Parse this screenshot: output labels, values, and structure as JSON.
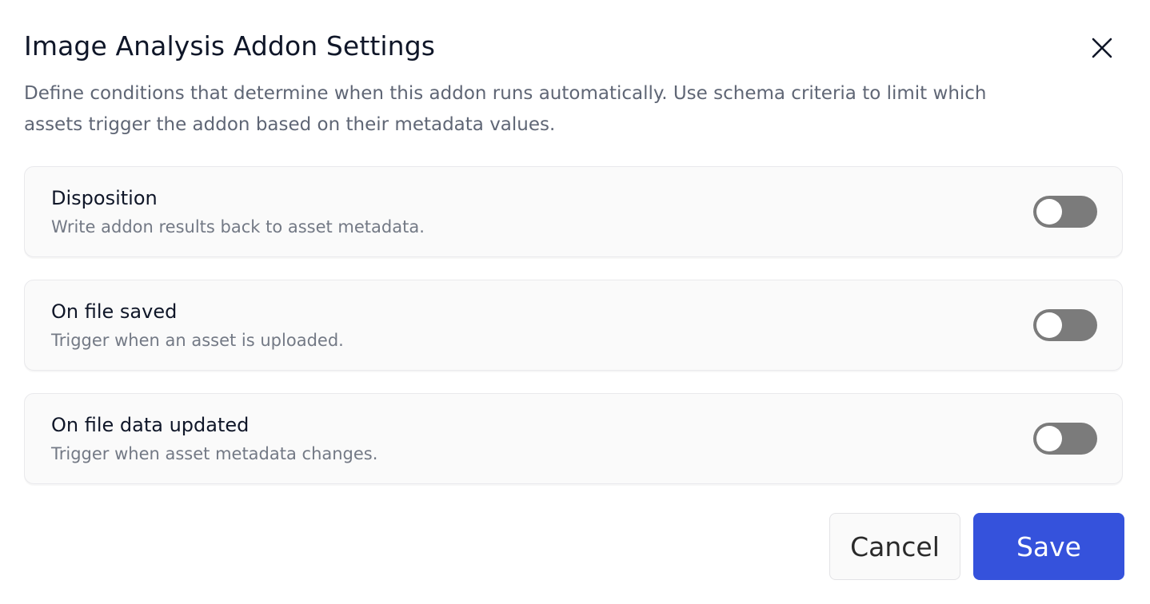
{
  "dialog": {
    "title": "Image Analysis Addon Settings",
    "description": "Define conditions that determine when this addon runs automatically. Use schema criteria to limit which assets trigger the addon based on their metadata values.",
    "close_icon": "close-icon"
  },
  "settings": [
    {
      "title": "Disposition",
      "description": "Write addon results back to asset metadata.",
      "enabled": false
    },
    {
      "title": "On file saved",
      "description": "Trigger when an asset is uploaded.",
      "enabled": false
    },
    {
      "title": "On file data updated",
      "description": "Trigger when asset metadata changes.",
      "enabled": false
    }
  ],
  "actions": {
    "cancel_label": "Cancel",
    "save_label": "Save"
  },
  "colors": {
    "accent": "#3552dc",
    "toggle_off": "#7b7b7b",
    "title_text": "#0f1628",
    "muted_text": "#5f6675"
  }
}
